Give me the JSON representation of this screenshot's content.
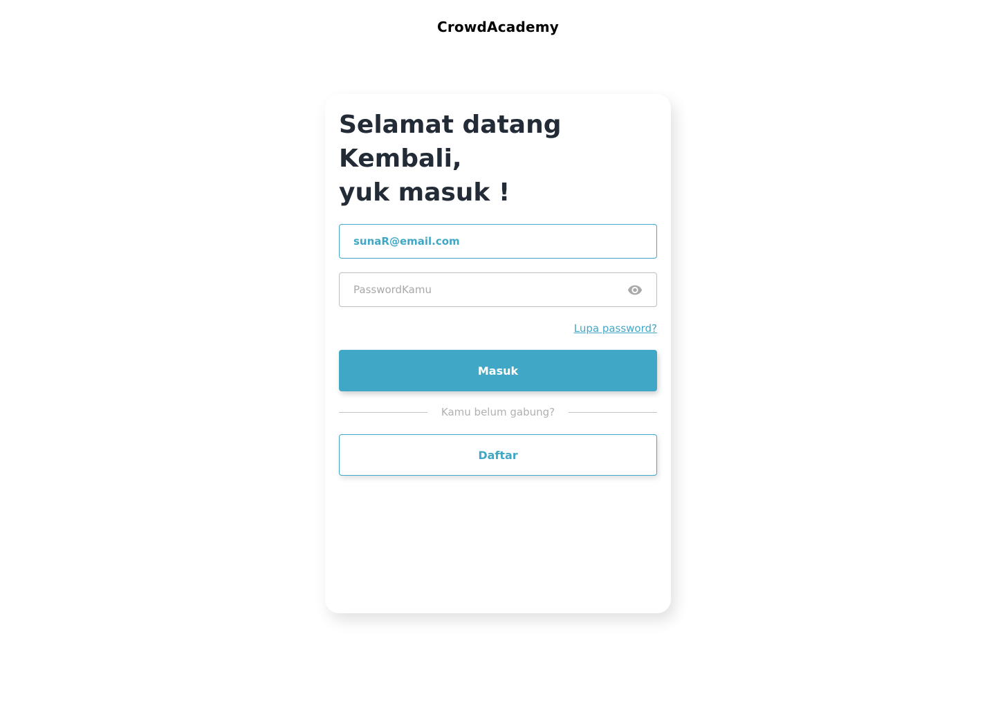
{
  "brand": {
    "name": "CrowdAcademy"
  },
  "login": {
    "heading_line1": "Selamat datang",
    "heading_line2": "Kembali,",
    "heading_line3": "yuk masuk !",
    "email_value": "sunaR@email.com",
    "password_placeholder": "PasswordKamu",
    "password_toggle_icon": "eye-icon",
    "forgot_label": "Lupa password?",
    "submit_label": "Masuk",
    "divider_text": "Kamu belum gabung?",
    "register_label": "Daftar"
  },
  "colors": {
    "accent": "#40a8c6",
    "heading": "#222b36",
    "muted": "#b0b0b0"
  }
}
